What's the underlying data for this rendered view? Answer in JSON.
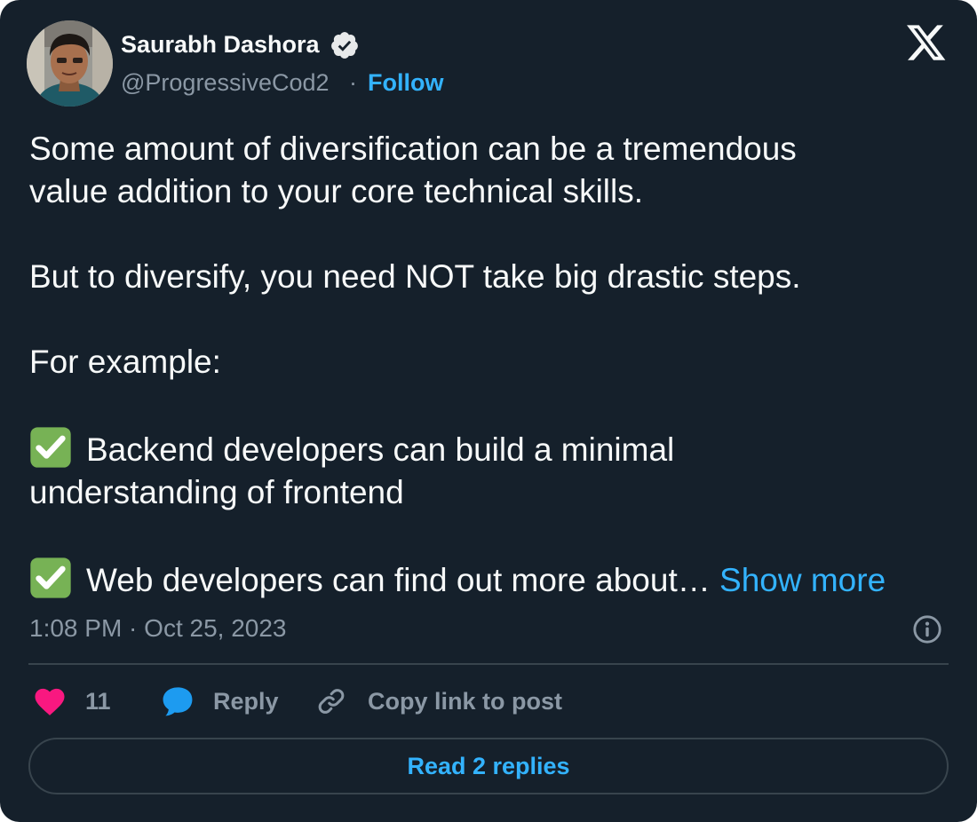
{
  "author": {
    "name": "Saurabh Dashora",
    "handle": "@ProgressiveCod2",
    "separator": "·",
    "follow_label": "Follow",
    "verified": true
  },
  "tweet": {
    "paragraphs": [
      "Some amount of diversification can be a tremendous",
      "value addition to your core technical skills.",
      "But to diversify, you need NOT take big drastic steps.",
      "For example:",
      "Backend developers can build a minimal",
      "understanding of frontend",
      "Web developers can find out more about…"
    ],
    "show_more_label": "Show more",
    "timestamp": "1:08 PM · Oct 25, 2023"
  },
  "actions": {
    "like_count": "11",
    "reply_label": "Reply",
    "copy_link_label": "Copy link to post"
  },
  "read_replies_label": "Read 2 replies",
  "icons": {
    "logo": "x-logo-icon",
    "verified": "verified-badge-icon",
    "check": "white-check-mark-icon",
    "info": "info-icon",
    "like": "heart-icon",
    "reply": "speech-bubble-icon",
    "link": "link-icon"
  },
  "colors": {
    "background": "#15202b",
    "text": "#f7f9f9",
    "muted": "#8b98a5",
    "accent": "#1d9bf0",
    "like": "#f91880",
    "check": "#77b255",
    "divider": "#38444d"
  }
}
